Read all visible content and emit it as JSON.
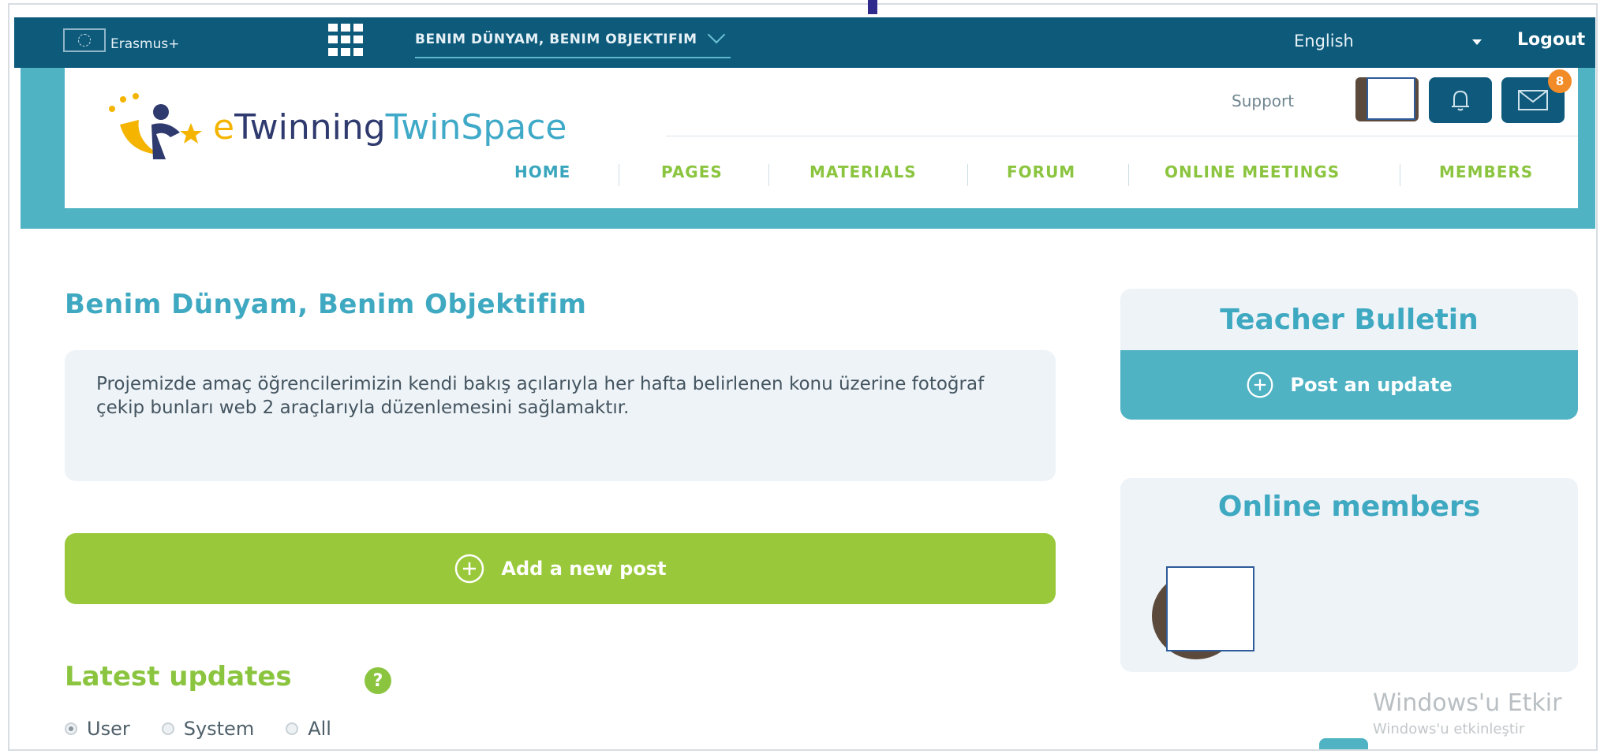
{
  "topbar": {
    "program": "Erasmus+",
    "project_name": "BENIM DÜNYAM, BENIM OBJEKTIFIM",
    "language": "English",
    "logout": "Logout"
  },
  "header": {
    "logo": {
      "e": "e",
      "twinning": "Twinning",
      "twinspace": "TwinSpace"
    },
    "support": "Support",
    "notification_badge": "8",
    "nav": [
      {
        "label": "HOME"
      },
      {
        "label": "PAGES"
      },
      {
        "label": "MATERIALS"
      },
      {
        "label": "FORUM"
      },
      {
        "label": "ONLINE MEETINGS"
      },
      {
        "label": "MEMBERS"
      }
    ]
  },
  "main": {
    "title": "Benim Dünyam, Benim Objektifim",
    "description": "Projemizde amaç öğrencilerimizin kendi bakış açılarıyla her hafta belirlenen konu üzerine fotoğraf çekip bunları web 2 araçlarıyla düzenlemesini sağlamaktır.",
    "add_post": "Add a new post",
    "latest_updates": "Latest updates",
    "help_symbol": "?",
    "filters": [
      {
        "label": "User",
        "checked": true
      },
      {
        "label": "System",
        "checked": false
      },
      {
        "label": "All",
        "checked": false
      }
    ]
  },
  "sidebar": {
    "bulletin_title": "Teacher Bulletin",
    "post_update": "Post an update",
    "online_title": "Online members"
  },
  "watermark": {
    "line1": "Windows'u Etkir",
    "line2": "Windows'u etkinleştir"
  },
  "colors": {
    "topbar": "#0d5a7b",
    "teal": "#4fb3c4",
    "green": "#99c93a",
    "title_teal": "#3fa9c2"
  }
}
